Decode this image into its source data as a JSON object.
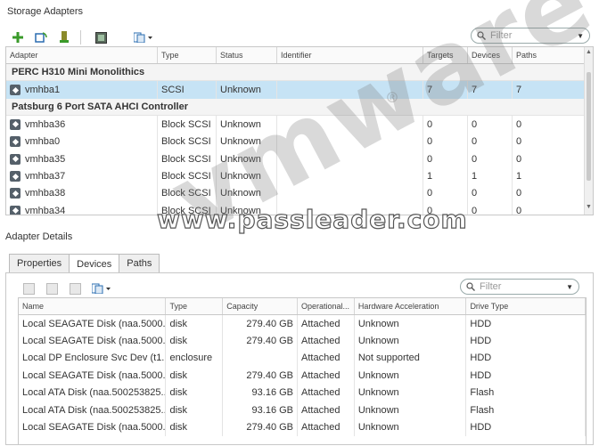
{
  "storage_adapters": {
    "title": "Storage Adapters",
    "filter_placeholder": "Filter",
    "columns": [
      "Adapter",
      "Type",
      "Status",
      "Identifier",
      "Targets",
      "Devices",
      "Paths"
    ],
    "groups": [
      {
        "name": "PERC H310 Mini Monolithics",
        "rows": [
          {
            "adapter": "vmhba1",
            "type": "SCSI",
            "status": "Unknown",
            "identifier": "",
            "targets": "7",
            "devices": "7",
            "paths": "7",
            "selected": true
          }
        ]
      },
      {
        "name": "Patsburg 6 Port SATA AHCI Controller",
        "rows": [
          {
            "adapter": "vmhba36",
            "type": "Block SCSI",
            "status": "Unknown",
            "identifier": "",
            "targets": "0",
            "devices": "0",
            "paths": "0"
          },
          {
            "adapter": "vmhba0",
            "type": "Block SCSI",
            "status": "Unknown",
            "identifier": "",
            "targets": "0",
            "devices": "0",
            "paths": "0"
          },
          {
            "adapter": "vmhba35",
            "type": "Block SCSI",
            "status": "Unknown",
            "identifier": "",
            "targets": "0",
            "devices": "0",
            "paths": "0"
          },
          {
            "adapter": "vmhba37",
            "type": "Block SCSI",
            "status": "Unknown",
            "identifier": "",
            "targets": "1",
            "devices": "1",
            "paths": "1"
          },
          {
            "adapter": "vmhba38",
            "type": "Block SCSI",
            "status": "Unknown",
            "identifier": "",
            "targets": "0",
            "devices": "0",
            "paths": "0"
          },
          {
            "adapter": "vmhba34",
            "type": "Block SCSI",
            "status": "Unknown",
            "identifier": "",
            "targets": "0",
            "devices": "0",
            "paths": "0"
          }
        ]
      }
    ]
  },
  "adapter_details": {
    "title": "Adapter Details",
    "tabs": [
      "Properties",
      "Devices",
      "Paths"
    ],
    "active_tab": "Devices",
    "filter_placeholder": "Filter",
    "columns": [
      "Name",
      "Type",
      "Capacity",
      "Operational...",
      "Hardware Acceleration",
      "Drive Type"
    ],
    "rows": [
      {
        "name": "Local SEAGATE Disk (naa.5000...",
        "type": "disk",
        "capacity": "279.40 GB",
        "operational": "Attached",
        "hw_accel": "Unknown",
        "drive_type": "HDD"
      },
      {
        "name": "Local SEAGATE Disk (naa.5000...",
        "type": "disk",
        "capacity": "279.40 GB",
        "operational": "Attached",
        "hw_accel": "Unknown",
        "drive_type": "HDD"
      },
      {
        "name": "Local DP Enclosure Svc Dev (t1...",
        "type": "enclosure",
        "capacity": "",
        "operational": "Attached",
        "hw_accel": "Not supported",
        "drive_type": "HDD"
      },
      {
        "name": "Local SEAGATE Disk (naa.5000...",
        "type": "disk",
        "capacity": "279.40 GB",
        "operational": "Attached",
        "hw_accel": "Unknown",
        "drive_type": "HDD"
      },
      {
        "name": "Local ATA Disk (naa.500253825...",
        "type": "disk",
        "capacity": "93.16 GB",
        "operational": "Attached",
        "hw_accel": "Unknown",
        "drive_type": "Flash"
      },
      {
        "name": "Local ATA Disk (naa.500253825...",
        "type": "disk",
        "capacity": "93.16 GB",
        "operational": "Attached",
        "hw_accel": "Unknown",
        "drive_type": "Flash"
      },
      {
        "name": "Local SEAGATE Disk (naa.5000...",
        "type": "disk",
        "capacity": "279.40 GB",
        "operational": "Attached",
        "hw_accel": "Unknown",
        "drive_type": "HDD"
      }
    ]
  },
  "watermarks": {
    "brand": "vmware",
    "registered": "®",
    "site": "www.passleader.com"
  },
  "colors": {
    "selection": "#c6e3f5",
    "add_icon": "#3a9a2a",
    "accent_blue": "#2a6cb0"
  }
}
